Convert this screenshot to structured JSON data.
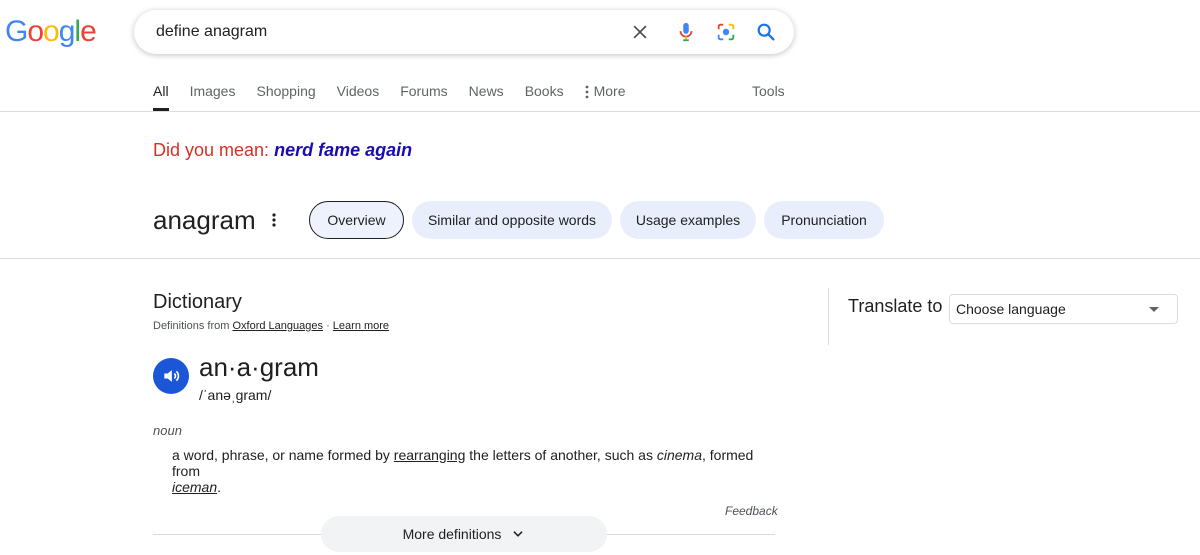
{
  "logo": {
    "letters": [
      {
        "char": "G",
        "color": "#4285F4"
      },
      {
        "char": "o",
        "color": "#EA4335"
      },
      {
        "char": "o",
        "color": "#FBBC05"
      },
      {
        "char": "g",
        "color": "#4285F4"
      },
      {
        "char": "l",
        "color": "#34A853"
      },
      {
        "char": "e",
        "color": "#EA4335"
      }
    ]
  },
  "search": {
    "query": "define anagram",
    "icons": [
      "close-icon",
      "microphone-icon",
      "lens-icon",
      "search-icon"
    ]
  },
  "tabs": {
    "items": [
      "All",
      "Images",
      "Shopping",
      "Videos",
      "Forums",
      "News",
      "Books"
    ],
    "more": "More",
    "tools": "Tools",
    "active": "All"
  },
  "did_you_mean": {
    "label": "Did you mean:",
    "suggestion": "nerd fame again"
  },
  "word": {
    "title": "anagram",
    "chips": [
      "Overview",
      "Similar and opposite words",
      "Usage examples",
      "Pronunciation"
    ],
    "selected_chip": "Overview"
  },
  "dictionary": {
    "title": "Dictionary",
    "source_prefix": "Definitions from",
    "source_link": "Oxford Languages",
    "separator": "·",
    "learn_more": "Learn more",
    "headword": "an·a·gram",
    "phonetic": "/ˈanəˌɡram/",
    "part_of_speech": "noun",
    "definition": {
      "part1": "a word, phrase, or name formed by ",
      "link1": "rearranging",
      "part2": " the letters of another, such as ",
      "example1": "cinema",
      "part3": ", formed from ",
      "example2": "iceman",
      "part4": "."
    },
    "feedback": "Feedback",
    "more_definitions": "More definitions"
  },
  "translate": {
    "label": "Translate to",
    "placeholder": "Choose language"
  },
  "colors": {
    "accent_blue": "#1a56d6",
    "link_blue": "#1a0dab",
    "did_you_mean_red": "#d93025",
    "chip_bg": "#e8eefc"
  }
}
